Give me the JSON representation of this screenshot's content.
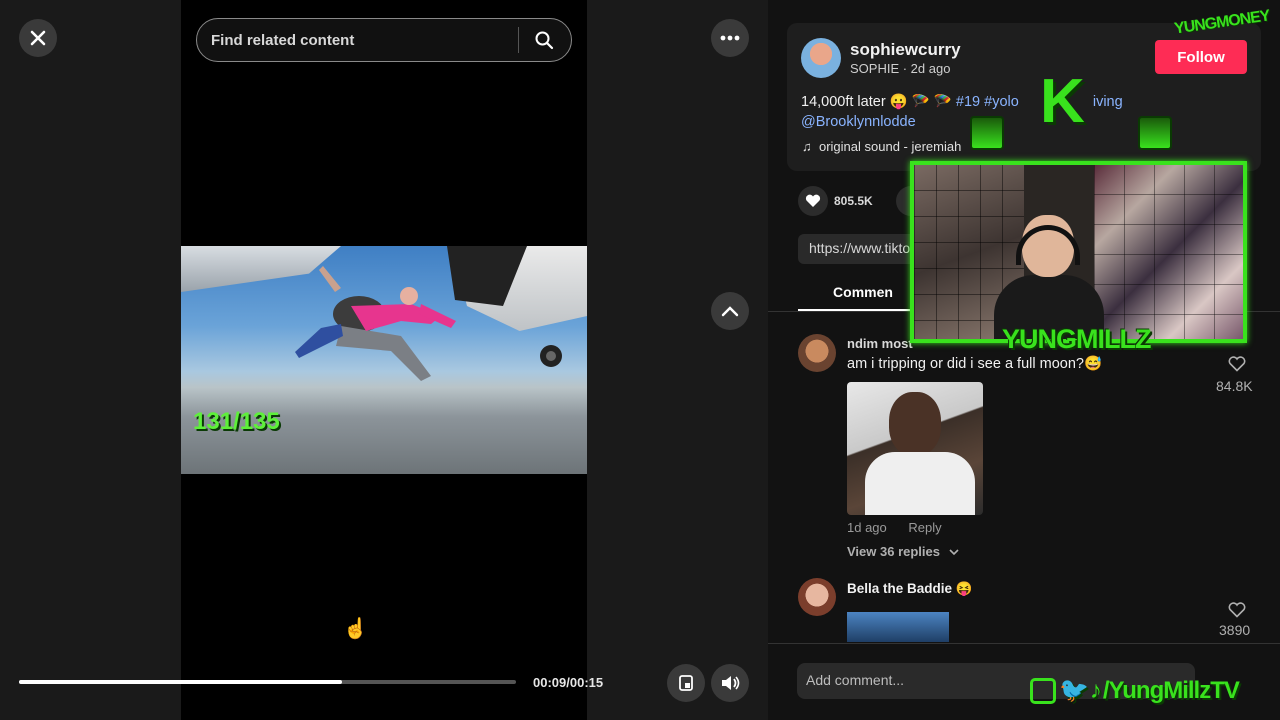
{
  "player": {
    "search_placeholder": "Find related content",
    "progress_fraction": 0.65,
    "time": "00:09/00:15",
    "overlay_counter": "131/135"
  },
  "post": {
    "username": "sophiewcurry",
    "display": "SOPHIE · 2d ago",
    "follow_label": "Follow",
    "caption_text": "14,000ft later 😛 🪂 🪂",
    "caption_tags": "#19 #yolo",
    "caption_tail": "iving",
    "mention": "@Brooklynnlodde",
    "sound": "original sound - jeremiah",
    "likes": "805.5K",
    "link": "https://www.tiktok",
    "tab_comments": "Commen"
  },
  "comments": [
    {
      "name": "ndim most",
      "text": "am i tripping or did i see a full moon?😅",
      "age": "1d ago",
      "reply": "Reply",
      "view_replies": "View 36 replies",
      "likes": "84.8K"
    },
    {
      "name": "Bella the Baddie 😝",
      "likes": "3890"
    }
  ],
  "comment_input_placeholder": "Add comment...",
  "stream_overlay": {
    "name": "YUNGMILLZ",
    "letter": "K",
    "brand": "YUNGMONEY",
    "social": "/YungMillzTV",
    "accent": "#39e21d"
  },
  "colors": {
    "follow_button": "#fe2c55",
    "hashtag": "#8ab4ff",
    "background": "#121212"
  }
}
